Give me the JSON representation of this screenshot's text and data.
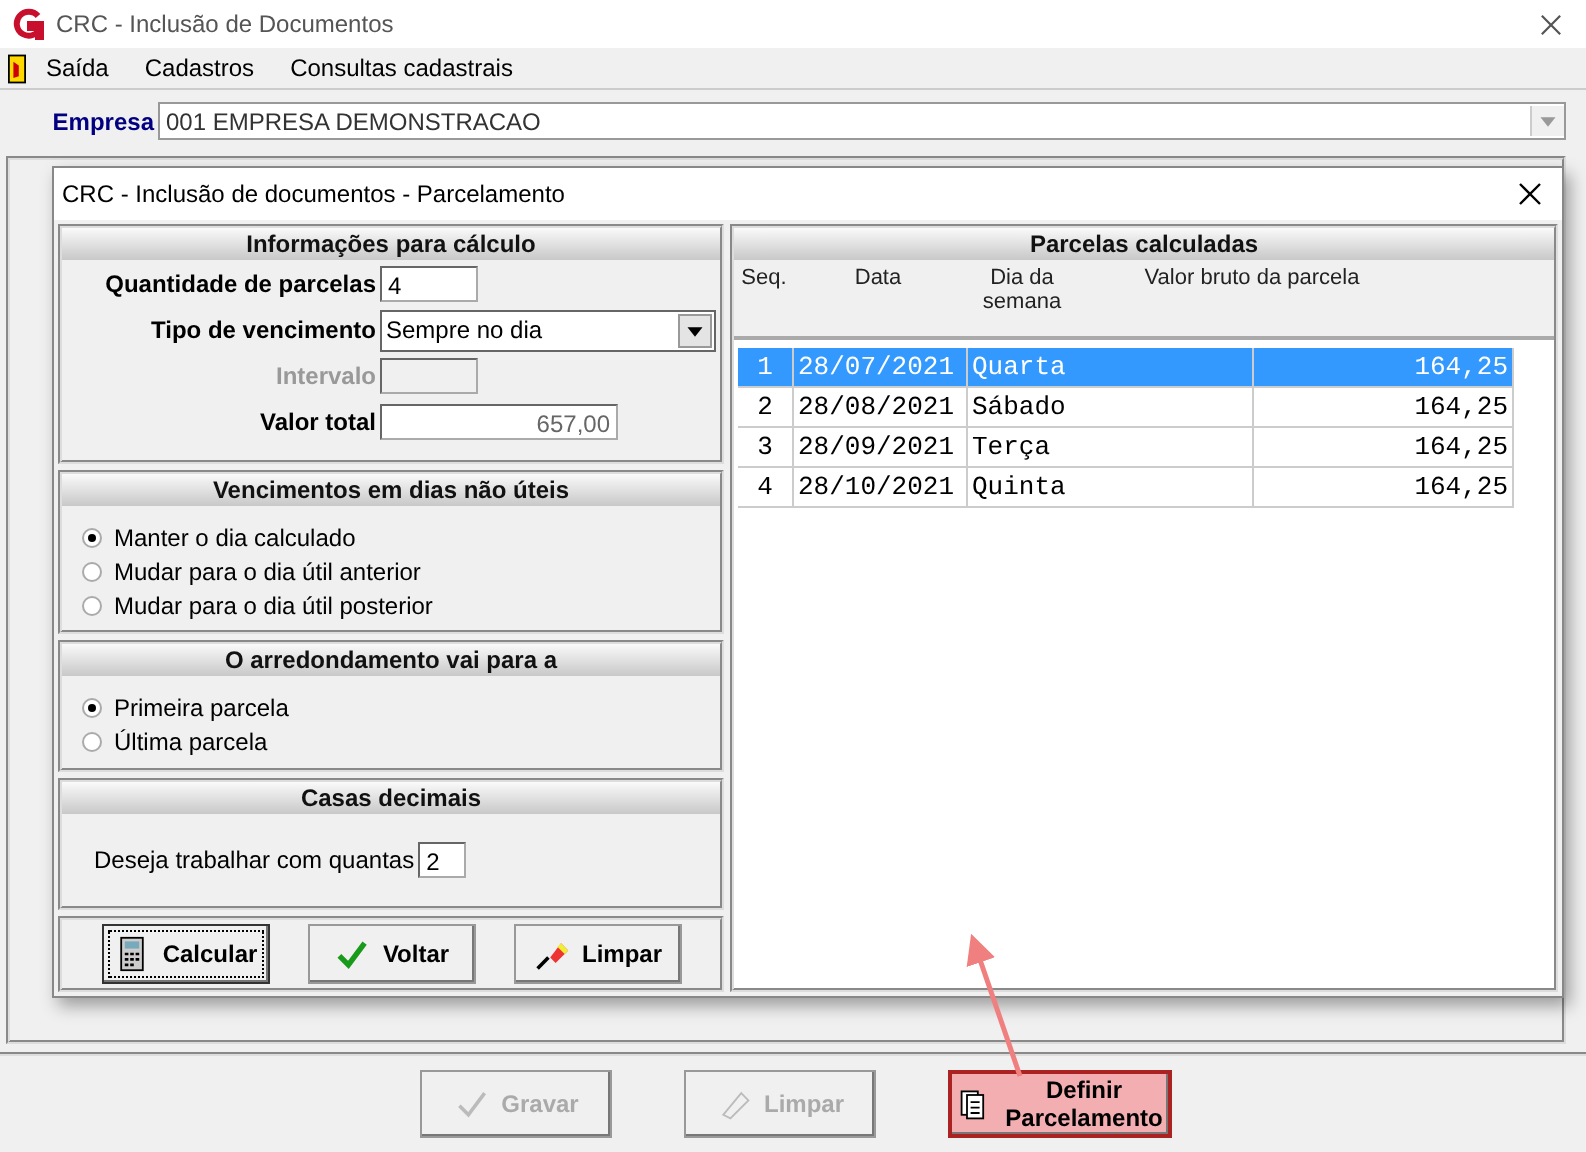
{
  "window": {
    "title": "CRC - Inclusão de Documentos"
  },
  "menu": [
    {
      "label": "Saída"
    },
    {
      "label": "Cadastros"
    },
    {
      "label": "Consultas cadastrais"
    }
  ],
  "empresa": {
    "label": "Empresa",
    "value": "001 EMPRESA DEMONSTRACAO"
  },
  "bottom_buttons": [
    {
      "label": "Gravar",
      "disabled": true,
      "kind": "normal"
    },
    {
      "label": "Limpar",
      "disabled": true,
      "kind": "normal"
    },
    {
      "label": "Definir Parcelamento",
      "disabled": false,
      "kind": "highlighted"
    }
  ],
  "dialog": {
    "title": "CRC - Inclusão de documentos - Parcelamento",
    "calc": {
      "title": "Informações para cálculo",
      "fields": [
        {
          "label": "Quantidade de parcelas",
          "value": "4",
          "kind": "text",
          "disabled": false
        },
        {
          "label": "Tipo de vencimento",
          "value": "Sempre no dia",
          "kind": "select",
          "disabled": false
        },
        {
          "label": "Intervalo",
          "kind": "text",
          "disabled": true
        },
        {
          "label": "Valor total",
          "value": "657,00",
          "kind": "readonly",
          "disabled": false
        }
      ]
    },
    "nonworking": {
      "title": "Vencimentos em dias não úteis",
      "options": [
        {
          "label": "Manter o dia calculado",
          "selected": true
        },
        {
          "label": "Mudar para o dia útil anterior",
          "selected": false
        },
        {
          "label": "Mudar para o dia útil posterior",
          "selected": false
        }
      ]
    },
    "rounding": {
      "title": "O arredondamento vai para a",
      "options": [
        {
          "label": "Primeira parcela",
          "selected": true
        },
        {
          "label": "Última parcela",
          "selected": false
        }
      ]
    },
    "decimals": {
      "title": "Casas decimais",
      "label": "Deseja trabalhar com quantas",
      "value": "2"
    },
    "buttons": [
      {
        "label": "Calcular",
        "focused": true
      },
      {
        "label": "Voltar",
        "focused": false
      },
      {
        "label": "Limpar",
        "focused": false
      }
    ],
    "results": {
      "title": "Parcelas calculadas",
      "columns": [
        "Seq.",
        "Data",
        "Dia da semana",
        "Valor bruto da parcela"
      ],
      "rows": [
        {
          "seq": "1",
          "date": "28/07/2021",
          "weekday": "Quarta",
          "value": "164,25",
          "selected": true
        },
        {
          "seq": "2",
          "date": "28/08/2021",
          "weekday": "Sábado",
          "value": "164,25",
          "selected": false
        },
        {
          "seq": "3",
          "date": "28/09/2021",
          "weekday": "Terça",
          "value": "164,25",
          "selected": false
        },
        {
          "seq": "4",
          "date": "28/10/2021",
          "weekday": "Quinta",
          "value": "164,25",
          "selected": false
        }
      ]
    }
  }
}
